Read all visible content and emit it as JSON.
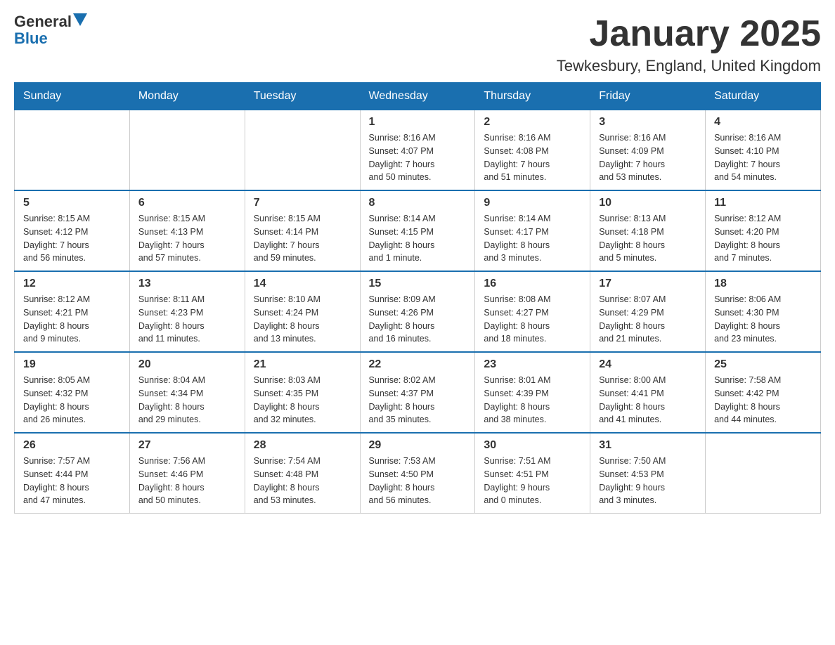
{
  "logo": {
    "general": "General",
    "blue": "Blue"
  },
  "title": "January 2025",
  "location": "Tewkesbury, England, United Kingdom",
  "days_of_week": [
    "Sunday",
    "Monday",
    "Tuesday",
    "Wednesday",
    "Thursday",
    "Friday",
    "Saturday"
  ],
  "weeks": [
    [
      {
        "day": "",
        "info": ""
      },
      {
        "day": "",
        "info": ""
      },
      {
        "day": "",
        "info": ""
      },
      {
        "day": "1",
        "info": "Sunrise: 8:16 AM\nSunset: 4:07 PM\nDaylight: 7 hours\nand 50 minutes."
      },
      {
        "day": "2",
        "info": "Sunrise: 8:16 AM\nSunset: 4:08 PM\nDaylight: 7 hours\nand 51 minutes."
      },
      {
        "day": "3",
        "info": "Sunrise: 8:16 AM\nSunset: 4:09 PM\nDaylight: 7 hours\nand 53 minutes."
      },
      {
        "day": "4",
        "info": "Sunrise: 8:16 AM\nSunset: 4:10 PM\nDaylight: 7 hours\nand 54 minutes."
      }
    ],
    [
      {
        "day": "5",
        "info": "Sunrise: 8:15 AM\nSunset: 4:12 PM\nDaylight: 7 hours\nand 56 minutes."
      },
      {
        "day": "6",
        "info": "Sunrise: 8:15 AM\nSunset: 4:13 PM\nDaylight: 7 hours\nand 57 minutes."
      },
      {
        "day": "7",
        "info": "Sunrise: 8:15 AM\nSunset: 4:14 PM\nDaylight: 7 hours\nand 59 minutes."
      },
      {
        "day": "8",
        "info": "Sunrise: 8:14 AM\nSunset: 4:15 PM\nDaylight: 8 hours\nand 1 minute."
      },
      {
        "day": "9",
        "info": "Sunrise: 8:14 AM\nSunset: 4:17 PM\nDaylight: 8 hours\nand 3 minutes."
      },
      {
        "day": "10",
        "info": "Sunrise: 8:13 AM\nSunset: 4:18 PM\nDaylight: 8 hours\nand 5 minutes."
      },
      {
        "day": "11",
        "info": "Sunrise: 8:12 AM\nSunset: 4:20 PM\nDaylight: 8 hours\nand 7 minutes."
      }
    ],
    [
      {
        "day": "12",
        "info": "Sunrise: 8:12 AM\nSunset: 4:21 PM\nDaylight: 8 hours\nand 9 minutes."
      },
      {
        "day": "13",
        "info": "Sunrise: 8:11 AM\nSunset: 4:23 PM\nDaylight: 8 hours\nand 11 minutes."
      },
      {
        "day": "14",
        "info": "Sunrise: 8:10 AM\nSunset: 4:24 PM\nDaylight: 8 hours\nand 13 minutes."
      },
      {
        "day": "15",
        "info": "Sunrise: 8:09 AM\nSunset: 4:26 PM\nDaylight: 8 hours\nand 16 minutes."
      },
      {
        "day": "16",
        "info": "Sunrise: 8:08 AM\nSunset: 4:27 PM\nDaylight: 8 hours\nand 18 minutes."
      },
      {
        "day": "17",
        "info": "Sunrise: 8:07 AM\nSunset: 4:29 PM\nDaylight: 8 hours\nand 21 minutes."
      },
      {
        "day": "18",
        "info": "Sunrise: 8:06 AM\nSunset: 4:30 PM\nDaylight: 8 hours\nand 23 minutes."
      }
    ],
    [
      {
        "day": "19",
        "info": "Sunrise: 8:05 AM\nSunset: 4:32 PM\nDaylight: 8 hours\nand 26 minutes."
      },
      {
        "day": "20",
        "info": "Sunrise: 8:04 AM\nSunset: 4:34 PM\nDaylight: 8 hours\nand 29 minutes."
      },
      {
        "day": "21",
        "info": "Sunrise: 8:03 AM\nSunset: 4:35 PM\nDaylight: 8 hours\nand 32 minutes."
      },
      {
        "day": "22",
        "info": "Sunrise: 8:02 AM\nSunset: 4:37 PM\nDaylight: 8 hours\nand 35 minutes."
      },
      {
        "day": "23",
        "info": "Sunrise: 8:01 AM\nSunset: 4:39 PM\nDaylight: 8 hours\nand 38 minutes."
      },
      {
        "day": "24",
        "info": "Sunrise: 8:00 AM\nSunset: 4:41 PM\nDaylight: 8 hours\nand 41 minutes."
      },
      {
        "day": "25",
        "info": "Sunrise: 7:58 AM\nSunset: 4:42 PM\nDaylight: 8 hours\nand 44 minutes."
      }
    ],
    [
      {
        "day": "26",
        "info": "Sunrise: 7:57 AM\nSunset: 4:44 PM\nDaylight: 8 hours\nand 47 minutes."
      },
      {
        "day": "27",
        "info": "Sunrise: 7:56 AM\nSunset: 4:46 PM\nDaylight: 8 hours\nand 50 minutes."
      },
      {
        "day": "28",
        "info": "Sunrise: 7:54 AM\nSunset: 4:48 PM\nDaylight: 8 hours\nand 53 minutes."
      },
      {
        "day": "29",
        "info": "Sunrise: 7:53 AM\nSunset: 4:50 PM\nDaylight: 8 hours\nand 56 minutes."
      },
      {
        "day": "30",
        "info": "Sunrise: 7:51 AM\nSunset: 4:51 PM\nDaylight: 9 hours\nand 0 minutes."
      },
      {
        "day": "31",
        "info": "Sunrise: 7:50 AM\nSunset: 4:53 PM\nDaylight: 9 hours\nand 3 minutes."
      },
      {
        "day": "",
        "info": ""
      }
    ]
  ]
}
